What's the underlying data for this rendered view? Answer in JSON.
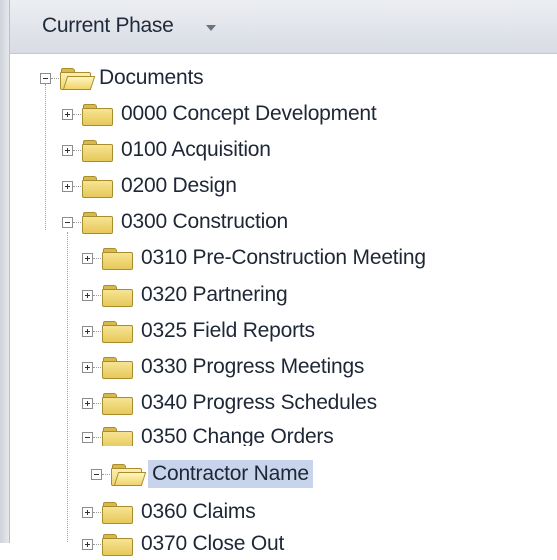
{
  "header": {
    "title": "Current Phase"
  },
  "tree": {
    "root": {
      "label": "Documents",
      "expanded": true
    },
    "level1": [
      {
        "label": "0000 Concept Development",
        "expanded": false
      },
      {
        "label": "0100 Acquisition",
        "expanded": false
      },
      {
        "label": "0200 Design",
        "expanded": false
      },
      {
        "label": "0300 Construction",
        "expanded": true
      }
    ],
    "level2": [
      {
        "label": "0310 Pre-Construction Meeting",
        "expanded": false
      },
      {
        "label": "0320 Partnering",
        "expanded": false
      },
      {
        "label": "0325 Field Reports",
        "expanded": false
      },
      {
        "label": "0330 Progress Meetings",
        "expanded": false
      },
      {
        "label": "0340 Progress Schedules",
        "expanded": false
      },
      {
        "label": "0350 Change Orders",
        "expanded": true
      },
      {
        "label": "0360 Claims",
        "expanded": false
      },
      {
        "label": "0370 Close Out",
        "expanded": false
      }
    ],
    "selected": {
      "label": "Contractor Name",
      "expanded": true
    }
  }
}
